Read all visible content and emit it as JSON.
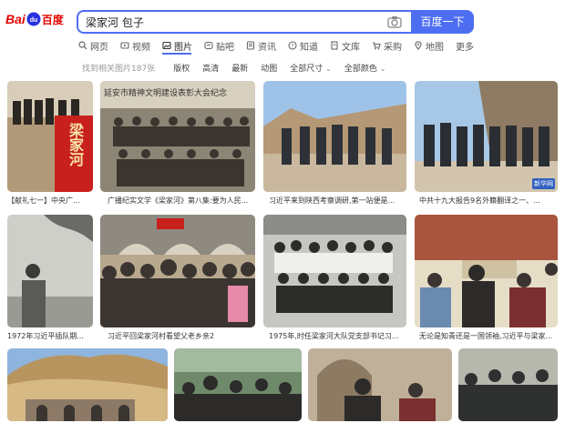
{
  "header": {
    "logo_left": "Bai",
    "logo_mid": "du",
    "logo_right": "百度",
    "search_value": "梁家河 包子",
    "search_button": "百度一下"
  },
  "tabs": [
    {
      "label": "网页",
      "icon": "search-icon"
    },
    {
      "label": "视频",
      "icon": "video-icon"
    },
    {
      "label": "图片",
      "icon": "image-icon",
      "active": true
    },
    {
      "label": "贴吧",
      "icon": "tieba-icon"
    },
    {
      "label": "资讯",
      "icon": "news-icon"
    },
    {
      "label": "知道",
      "icon": "zhidao-icon"
    },
    {
      "label": "文库",
      "icon": "wenku-icon"
    },
    {
      "label": "采购",
      "icon": "cart-icon"
    },
    {
      "label": "地图",
      "icon": "map-icon"
    },
    {
      "label": "更多",
      "icon": ""
    }
  ],
  "filters": {
    "count": "找到相关图片187张",
    "items": [
      "版权",
      "高清",
      "最新",
      "动图",
      "全部尺寸",
      "全部颜色"
    ]
  },
  "results": [
    {
      "caption": "【献礼七一】中央广..."
    },
    {
      "caption": "广播纪实文学《梁家河》第八集:要为人民..."
    },
    {
      "caption": "习近平来到陕西考察调研,第一站便是..."
    },
    {
      "caption": "中共十九大报告9名外籍翻译之一、..."
    },
    {
      "caption": "1972年习近平插队期..."
    },
    {
      "caption": "习近平回梁家河村看望父老乡亲2"
    },
    {
      "caption": "1975年,时任梁家河大队党支部书记习..."
    },
    {
      "caption": "无论是知青还是一国领袖,习近平与梁家..."
    },
    {
      "caption": ""
    },
    {
      "caption": ""
    },
    {
      "caption": ""
    },
    {
      "caption": ""
    }
  ],
  "overlays": {
    "tile1_red_text": "梁家河",
    "tile2_banner": "延安市精神文明建设表彰大会纪念",
    "tile4_watermark": "新华网"
  },
  "colors": {
    "accent": "#4e6ef2",
    "brand_red": "#e10602"
  }
}
